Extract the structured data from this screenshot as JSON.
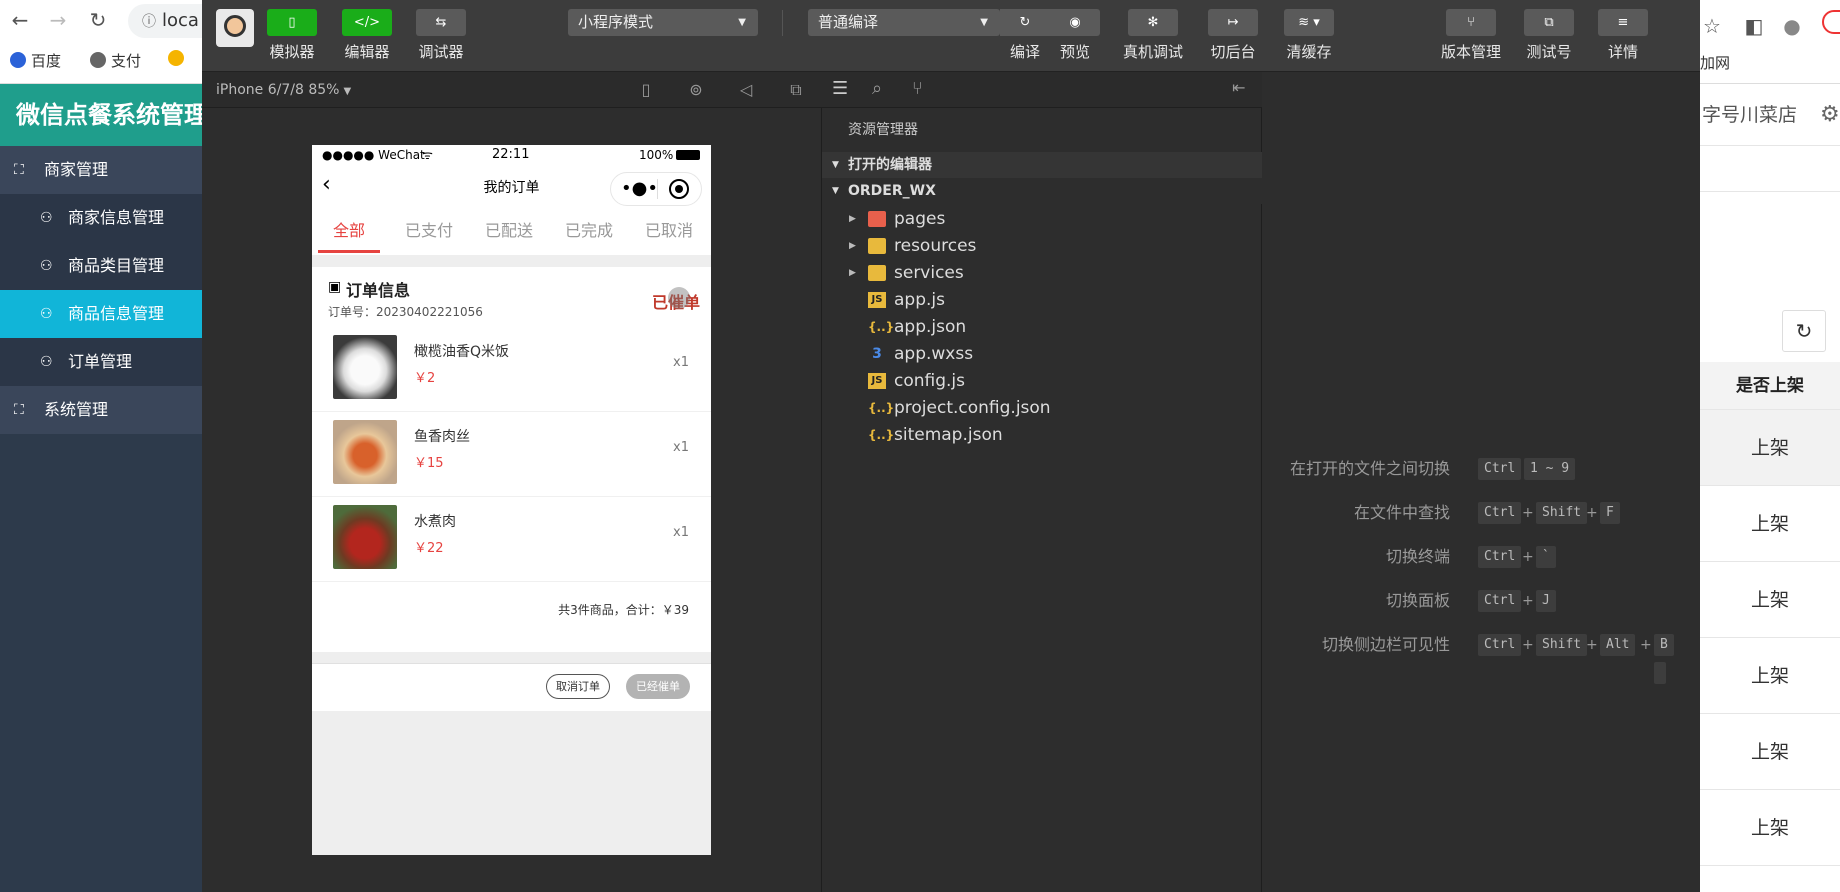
{
  "browser": {
    "address": "loca",
    "bookmarks": [
      "百度",
      "支付"
    ]
  },
  "admin": {
    "brand": "微信点餐系统管理",
    "groups": [
      {
        "label": "商家管理",
        "items": [
          "商家信息管理",
          "商品类目管理",
          "商品信息管理",
          "订单管理"
        ],
        "active": 2
      },
      {
        "label": "系统管理",
        "items": []
      }
    ],
    "right": {
      "top_text": "字号川菜店",
      "extra_text": "加网",
      "col_header": "是否上架",
      "rows": [
        "上架",
        "上架",
        "上架",
        "上架",
        "上架",
        "上架"
      ]
    }
  },
  "toolbar": {
    "left_buttons": [
      "模拟器",
      "编辑器",
      "调试器"
    ],
    "mode_select": "小程序模式",
    "compile_select": "普通编译",
    "mid_labels": [
      "编译",
      "预览",
      "真机调试",
      "切后台",
      "清缓存"
    ],
    "right_labels": [
      "版本管理",
      "测试号",
      "详情"
    ]
  },
  "simulator": {
    "device": "iPhone 6/7/8 85%",
    "status": {
      "carrier": "●●●●● WeChat",
      "time": "22:11",
      "battery": "100%"
    },
    "nav_title": "我的订单",
    "tabs": [
      "全部",
      "已支付",
      "已配送",
      "已完成",
      "已取消"
    ],
    "active_tab": 0,
    "order": {
      "title": "订单信息",
      "number_label": "订单号：20230402221056",
      "status": "已催单",
      "items": [
        {
          "name": "橄榄油香Q米饭",
          "price": "￥2",
          "qty": "x1"
        },
        {
          "name": "鱼香肉丝",
          "price": "￥15",
          "qty": "x1"
        },
        {
          "name": "水煮肉",
          "price": "￥22",
          "qty": "x1"
        }
      ],
      "summary": "共3件商品，合计：￥39",
      "cancel_btn": "取消订单",
      "urge_btn": "已经催单"
    }
  },
  "explorer": {
    "title": "资源管理器",
    "sections": [
      "打开的编辑器",
      "ORDER_WX"
    ],
    "files": [
      {
        "name": "pages",
        "type": "folder",
        "color": "#e8604c"
      },
      {
        "name": "resources",
        "type": "folder",
        "color": "#e8b93c"
      },
      {
        "name": "services",
        "type": "folder",
        "color": "#e8b93c"
      },
      {
        "name": "app.js",
        "type": "js"
      },
      {
        "name": "app.json",
        "type": "json"
      },
      {
        "name": "app.wxss",
        "type": "css"
      },
      {
        "name": "config.js",
        "type": "js"
      },
      {
        "name": "project.config.json",
        "type": "json"
      },
      {
        "name": "sitemap.json",
        "type": "json"
      }
    ]
  },
  "shortcuts": [
    {
      "label": "在打开的文件之间切换",
      "keys": [
        "Ctrl",
        "1 ~ 9"
      ]
    },
    {
      "label": "在文件中查找",
      "keys": [
        "Ctrl",
        "+",
        "Shift",
        "+",
        "F"
      ]
    },
    {
      "label": "切换终端",
      "keys": [
        "Ctrl",
        "+",
        "`"
      ]
    },
    {
      "label": "切换面板",
      "keys": [
        "Ctrl",
        "+",
        "J"
      ]
    },
    {
      "label": "切换侧边栏可见性",
      "keys": [
        "Ctrl",
        "+",
        "Shift",
        "+",
        "Alt",
        "+",
        "B"
      ]
    }
  ]
}
